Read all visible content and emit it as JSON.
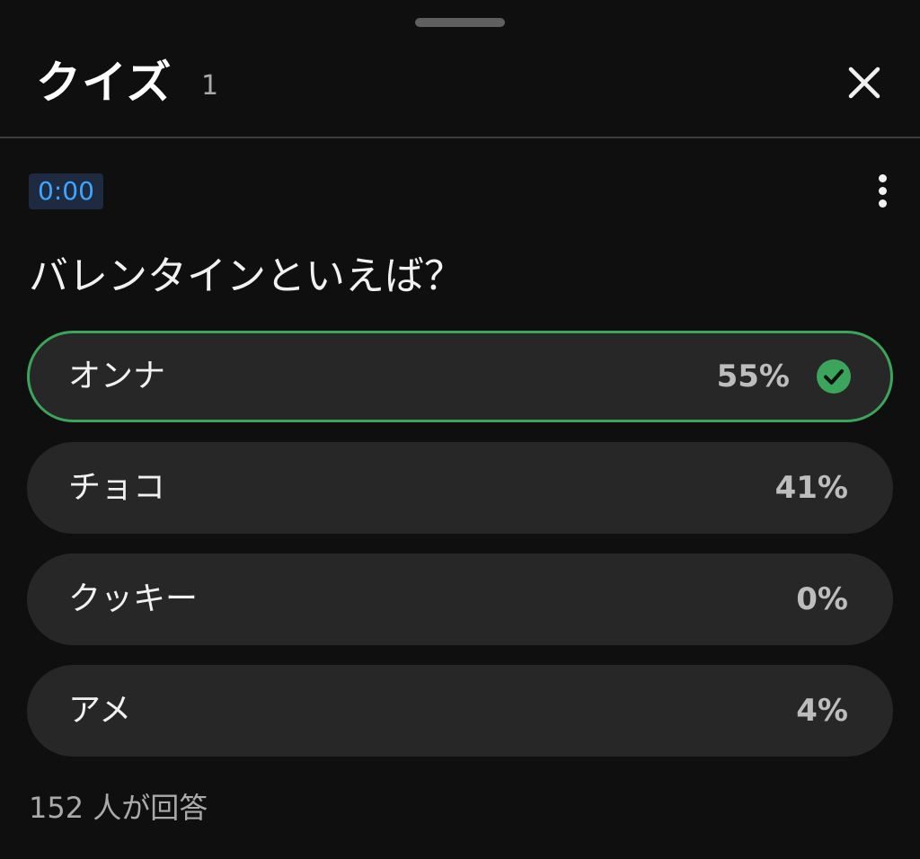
{
  "header": {
    "title": "クイズ",
    "count": "1"
  },
  "quiz": {
    "timestamp": "0:00",
    "question": "バレンタインといえば？",
    "options": [
      {
        "label": "オンナ",
        "percent": "55%",
        "correct": true
      },
      {
        "label": "チョコ",
        "percent": "41%",
        "correct": false
      },
      {
        "label": "クッキー",
        "percent": "0%",
        "correct": false
      },
      {
        "label": "アメ",
        "percent": "4%",
        "correct": false
      }
    ],
    "responses": "152 人が回答"
  },
  "colors": {
    "background": "#0f0f0f",
    "option_bg": "#272727",
    "correct_accent": "#3ba55c",
    "timestamp_text": "#3ea6ff"
  },
  "icons": {
    "close": "close-icon",
    "more": "more-vert-icon",
    "check": "check-circle-icon"
  }
}
